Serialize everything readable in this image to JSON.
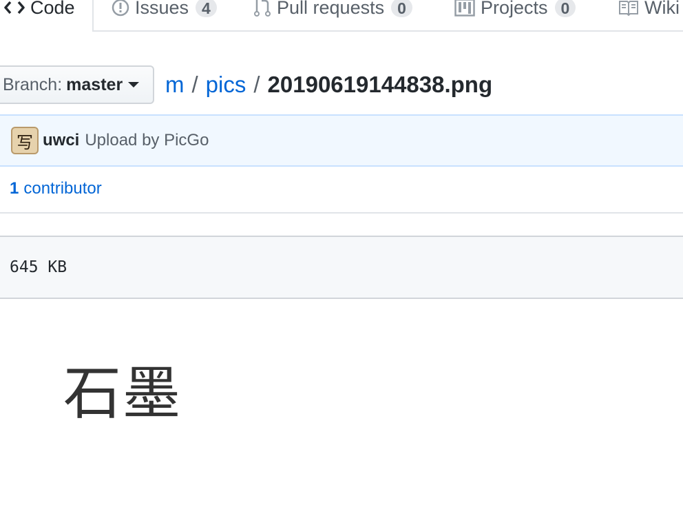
{
  "tabs": [
    {
      "label": "Code",
      "active": true
    },
    {
      "label": "Issues",
      "count": "4"
    },
    {
      "label": "Pull requests",
      "count": "0"
    },
    {
      "label": "Projects",
      "count": "0"
    },
    {
      "label": "Wiki"
    }
  ],
  "branch": {
    "label": "Branch:",
    "value": "master"
  },
  "breadcrumb": {
    "repo": "m",
    "folder": "pics",
    "file": "20190619144838.png",
    "separator": "/"
  },
  "commit": {
    "author": "uwci",
    "message": "Upload by PicGo",
    "avatar_glyph": "写"
  },
  "contributors": {
    "count": "1",
    "label": "contributor"
  },
  "file": {
    "size": "645 KB"
  },
  "image_text": "石墨",
  "colors": {
    "accent": "#e36209",
    "link": "#0366d6",
    "commit_bg": "#f1f8ff"
  }
}
